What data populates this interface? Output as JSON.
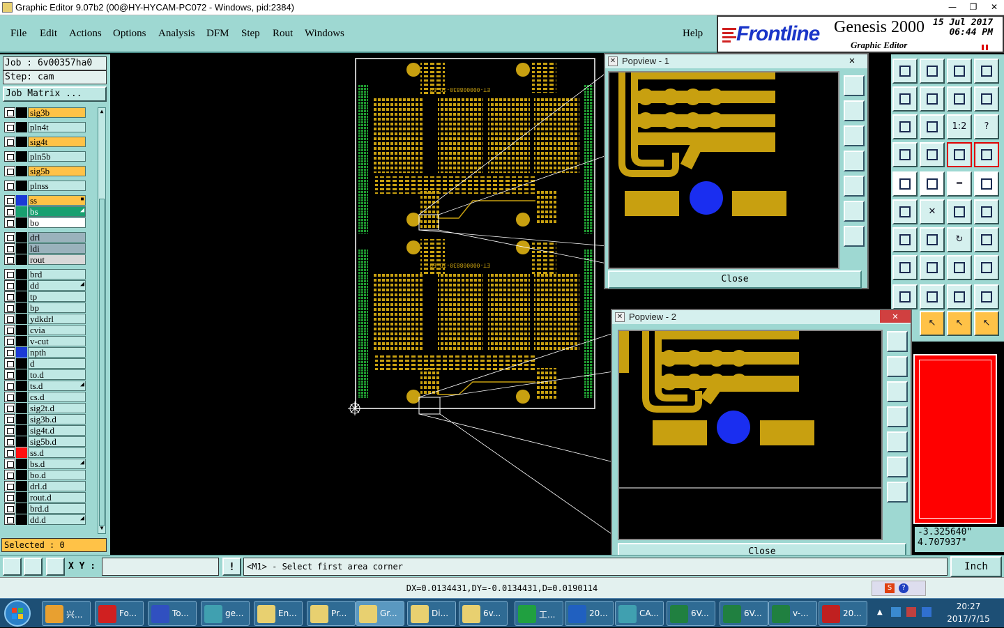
{
  "window": {
    "title": "Graphic Editor 9.07b2 (00@HY-HYCAM-PC072 - Windows, pid:2384)",
    "minimize": "—",
    "restore": "❐",
    "close": "✕"
  },
  "menu": [
    "File",
    "Edit",
    "Actions",
    "Options",
    "Analysis",
    "DFM",
    "Step",
    "Rout",
    "Windows"
  ],
  "help": "Help",
  "brand": {
    "logo": "Frontline",
    "product": "Genesis 2000",
    "subtitle": "Graphic Editor",
    "date": "15 Jul 2017",
    "time": "06:44 PM"
  },
  "job": {
    "label": "Job : 6v00357ha0",
    "step": "Step: cam",
    "matrix_button": "Job Matrix ..."
  },
  "layers": [
    {
      "name": "sig3b",
      "color": "#ffc247",
      "fg": "#000"
    },
    {
      "name": "pln4t",
      "color": "#bfe8e4",
      "fg": "#000"
    },
    {
      "name": "sig4t",
      "color": "#ffc247",
      "fg": "#000"
    },
    {
      "name": "pln5b",
      "color": "#bfe8e4",
      "fg": "#000"
    },
    {
      "name": "sig5b",
      "color": "#ffc247",
      "fg": "#000"
    },
    {
      "name": "plnss",
      "color": "#bfe8e4",
      "fg": "#000"
    },
    {
      "name": "ss",
      "color": "#ffc247",
      "fg": "#000",
      "swatch": "#1a3ad6",
      "mark": "▪"
    },
    {
      "name": "bs",
      "color": "#18a070",
      "fg": "#fff",
      "swatch": "#18a070",
      "mark": "◢"
    },
    {
      "name": "bo",
      "color": "#ffffff",
      "fg": "#000"
    },
    {
      "name": "drl",
      "color": "#9ab2bc",
      "fg": "#000"
    },
    {
      "name": "ldi",
      "color": "#9ab2bc",
      "fg": "#000"
    },
    {
      "name": "rout",
      "color": "#d8d8d8",
      "fg": "#000"
    },
    {
      "name": "brd",
      "color": "#bfe8e4",
      "fg": "#000"
    },
    {
      "name": "dd",
      "color": "#bfe8e4",
      "fg": "#000",
      "mark": "◢"
    },
    {
      "name": "tp",
      "color": "#bfe8e4",
      "fg": "#000"
    },
    {
      "name": "bp",
      "color": "#bfe8e4",
      "fg": "#000"
    },
    {
      "name": "ydkdrl",
      "color": "#bfe8e4",
      "fg": "#000"
    },
    {
      "name": "cvia",
      "color": "#bfe8e4",
      "fg": "#000"
    },
    {
      "name": "v-cut",
      "color": "#bfe8e4",
      "fg": "#000"
    },
    {
      "name": "npth",
      "color": "#bfe8e4",
      "fg": "#000",
      "swatch": "#1a3ad6"
    },
    {
      "name": "d",
      "color": "#bfe8e4",
      "fg": "#000"
    },
    {
      "name": "to.d",
      "color": "#bfe8e4",
      "fg": "#000"
    },
    {
      "name": "ts.d",
      "color": "#bfe8e4",
      "fg": "#000",
      "mark": "◢"
    },
    {
      "name": "cs.d",
      "color": "#bfe8e4",
      "fg": "#000"
    },
    {
      "name": "sig2t.d",
      "color": "#bfe8e4",
      "fg": "#000"
    },
    {
      "name": "sig3b.d",
      "color": "#bfe8e4",
      "fg": "#000"
    },
    {
      "name": "sig4t.d",
      "color": "#bfe8e4",
      "fg": "#000"
    },
    {
      "name": "sig5b.d",
      "color": "#bfe8e4",
      "fg": "#000"
    },
    {
      "name": "ss.d",
      "color": "#bfe8e4",
      "fg": "#000",
      "swatch": "#ff1010"
    },
    {
      "name": "bs.d",
      "color": "#bfe8e4",
      "fg": "#000",
      "mark": "◢"
    },
    {
      "name": "bo.d",
      "color": "#bfe8e4",
      "fg": "#000"
    },
    {
      "name": "drl.d",
      "color": "#bfe8e4",
      "fg": "#000"
    },
    {
      "name": "rout.d",
      "color": "#bfe8e4",
      "fg": "#000"
    },
    {
      "name": "brd.d",
      "color": "#bfe8e4",
      "fg": "#000"
    },
    {
      "name": "dd.d",
      "color": "#bfe8e4",
      "fg": "#000",
      "mark": "◢"
    }
  ],
  "selected": "Selected : 0",
  "board": {
    "label": "ET-000008830-ID EP",
    "label2": "ET-000008830-ID EP"
  },
  "popview1": {
    "title": "Popview - 1",
    "close": "Close",
    "close_x": "✕"
  },
  "popview2": {
    "title": "Popview - 2",
    "close": "Close",
    "close_x": "✕"
  },
  "coords": {
    "x": "-3.325640\"",
    "y": "4.707937\""
  },
  "cmd": {
    "xy_label": "X Y :",
    "xy_value": "",
    "alert": "!",
    "prompt": "<M1> - Select first area corner",
    "units": "Inch"
  },
  "status": "DX=0.0134431,DY=-0.0134431,D=0.0190114",
  "taskbar": {
    "items": [
      {
        "label": "兴...",
        "icon": "#e8a030"
      },
      {
        "label": "Fo...",
        "icon": "#d02020"
      },
      {
        "label": "To...",
        "icon": "#3050c0"
      },
      {
        "label": "ge...",
        "icon": "#40a0b0"
      },
      {
        "label": "En...",
        "icon": "#e8d070"
      },
      {
        "label": "Pr...",
        "icon": "#e8d070"
      },
      {
        "label": "Gr...",
        "icon": "#e8d070"
      },
      {
        "label": "Di...",
        "icon": "#e8d070"
      },
      {
        "label": "6v...",
        "icon": "#e8d070"
      },
      {
        "label": "工...",
        "icon": "#20a040"
      },
      {
        "label": "20...",
        "icon": "#2060c0"
      },
      {
        "label": "CA...",
        "icon": "#40a0b0"
      },
      {
        "label": "6V...",
        "icon": "#208040"
      },
      {
        "label": "6V...",
        "icon": "#208040"
      },
      {
        "label": "v-...",
        "icon": "#208040"
      },
      {
        "label": "20...",
        "icon": "#c02020"
      }
    ],
    "clock_time": "20:27",
    "clock_date": "2017/7/15"
  }
}
